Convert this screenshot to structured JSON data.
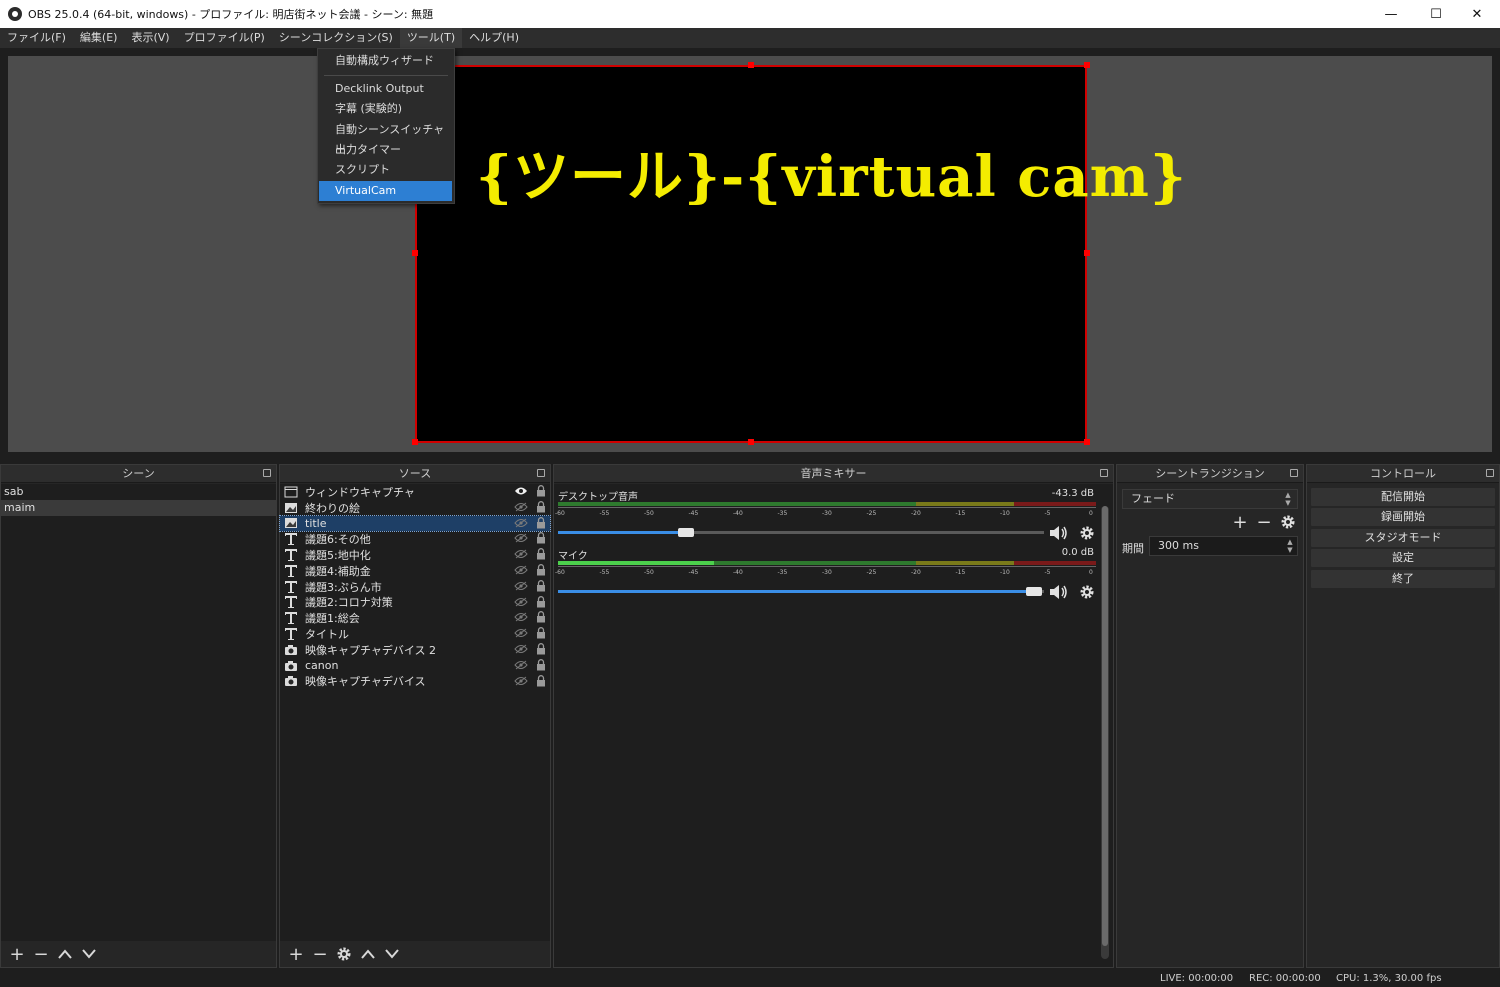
{
  "window": {
    "title": "OBS 25.0.4 (64-bit, windows) - プロファイル: 明店街ネット会議 - シーン: 無題",
    "minimize": "—",
    "maximize": "☐",
    "close": "✕"
  },
  "menu": [
    {
      "label": "ファイル(F)"
    },
    {
      "label": "編集(E)"
    },
    {
      "label": "表示(V)"
    },
    {
      "label": "プロファイル(P)"
    },
    {
      "label": "シーンコレクション(S)"
    },
    {
      "label": "ツール(T)"
    },
    {
      "label": "ヘルプ(H)"
    }
  ],
  "tools_menu": [
    {
      "label": "自動構成ウィザード"
    },
    {
      "label": "Decklink Output"
    },
    {
      "label": "字幕 (実験的)"
    },
    {
      "label": "自動シーンスイッチャー"
    },
    {
      "label": "出力タイマー"
    },
    {
      "label": "スクリプト"
    },
    {
      "label": "VirtualCam"
    }
  ],
  "preview": {
    "overlay_text": "{ツール}-{virtual cam}",
    "overlay_color": "#f4ec00",
    "border_color": "#d00000"
  },
  "scenes": {
    "title": "シーン",
    "items": [
      {
        "label": "sab"
      },
      {
        "label": "maim"
      }
    ],
    "selected_index": 1
  },
  "sources": {
    "title": "ソース",
    "items": [
      {
        "label": "ウィンドウキャプチャ",
        "icon": "window-capture-icon",
        "visible": true
      },
      {
        "label": "終わりの絵",
        "icon": "image-source-icon",
        "visible": false
      },
      {
        "label": "title",
        "icon": "image-source-icon",
        "visible": false
      },
      {
        "label": "議題6:その他",
        "icon": "text-source-icon",
        "visible": false
      },
      {
        "label": "議題5:地中化",
        "icon": "text-source-icon",
        "visible": false
      },
      {
        "label": "議題4:補助金",
        "icon": "text-source-icon",
        "visible": false
      },
      {
        "label": "議題3:ぷらん市",
        "icon": "text-source-icon",
        "visible": false
      },
      {
        "label": "議題2:コロナ対策",
        "icon": "text-source-icon",
        "visible": false
      },
      {
        "label": "議題1:総会",
        "icon": "text-source-icon",
        "visible": false
      },
      {
        "label": "タイトル",
        "icon": "text-source-icon",
        "visible": false
      },
      {
        "label": "映像キャプチャデバイス 2",
        "icon": "camera-source-icon",
        "visible": false
      },
      {
        "label": "canon",
        "icon": "camera-source-icon",
        "visible": false
      },
      {
        "label": "映像キャプチャデバイス",
        "icon": "camera-source-icon",
        "visible": false
      }
    ],
    "selected_index": 2
  },
  "mixer": {
    "title": "音声ミキサー",
    "scale_labels": [
      "-60",
      "-55",
      "-50",
      "-45",
      "-40",
      "-35",
      "-30",
      "-25",
      "-20",
      "-15",
      "-10",
      "-5",
      "0"
    ],
    "tracks": [
      {
        "name": "デスクトップ音声",
        "db": "-43.3 dB",
        "level": 0.0,
        "volume": 0.24
      },
      {
        "name": "マイク",
        "db": "0.0 dB",
        "level": 0.29,
        "volume": 0.97
      }
    ]
  },
  "transitions": {
    "title": "シーントランジション",
    "selected": "フェード",
    "duration_label": "期間",
    "duration_value": "300 ms"
  },
  "controls": {
    "title": "コントロール",
    "buttons": [
      {
        "label": "配信開始"
      },
      {
        "label": "録画開始"
      },
      {
        "label": "スタジオモード"
      },
      {
        "label": "設定"
      },
      {
        "label": "終了"
      }
    ]
  },
  "status": {
    "live": "LIVE: 00:00:00",
    "rec": "REC: 00:00:00",
    "cpu": "CPU: 1.3%, 30.00 fps"
  },
  "colors": {
    "accent": "#2d7fd3",
    "meter_green": "#2e8b2e",
    "meter_yellow": "#8b8b1a",
    "meter_red": "#8b1a1a"
  }
}
